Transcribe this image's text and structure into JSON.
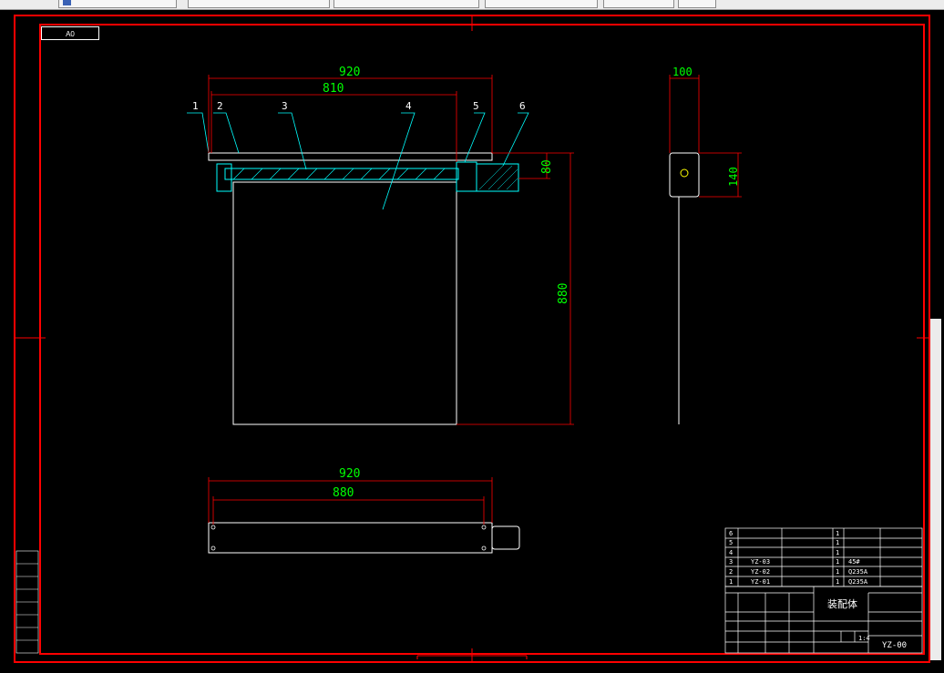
{
  "window": {
    "tabs": [
      "",
      "",
      "",
      "",
      "",
      ""
    ]
  },
  "sheet": {
    "size_label": "A0"
  },
  "dimensions": {
    "front_total": "920",
    "front_inner": "810",
    "front_side_thickness": "80",
    "front_height": "880",
    "side_width": "100",
    "side_height": "140",
    "bottom_total": "920",
    "bottom_inner": "880"
  },
  "balloons": [
    "1",
    "2",
    "3",
    "4",
    "5",
    "6"
  ],
  "bom": {
    "rows": [
      {
        "no": "6",
        "code": "",
        "name": "",
        "qty": "1",
        "material": ""
      },
      {
        "no": "5",
        "code": "",
        "name": "",
        "qty": "1",
        "material": ""
      },
      {
        "no": "4",
        "code": "",
        "name": "",
        "qty": "1",
        "material": ""
      },
      {
        "no": "3",
        "code": "YZ-03",
        "name": "",
        "qty": "1",
        "material": "45#"
      },
      {
        "no": "2",
        "code": "YZ-02",
        "name": "",
        "qty": "1",
        "material": "Q235A"
      },
      {
        "no": "1",
        "code": "YZ-01",
        "name": "",
        "qty": "1",
        "material": "Q235A"
      }
    ]
  },
  "title_block": {
    "drawing_name": "装配体",
    "scale": "1:4",
    "drawing_no": "YZ-00"
  },
  "colors": {
    "frame": "#ff0000",
    "outline": "#ffffff",
    "dimension_text": "#00ff00",
    "leader": "#00ffff"
  }
}
